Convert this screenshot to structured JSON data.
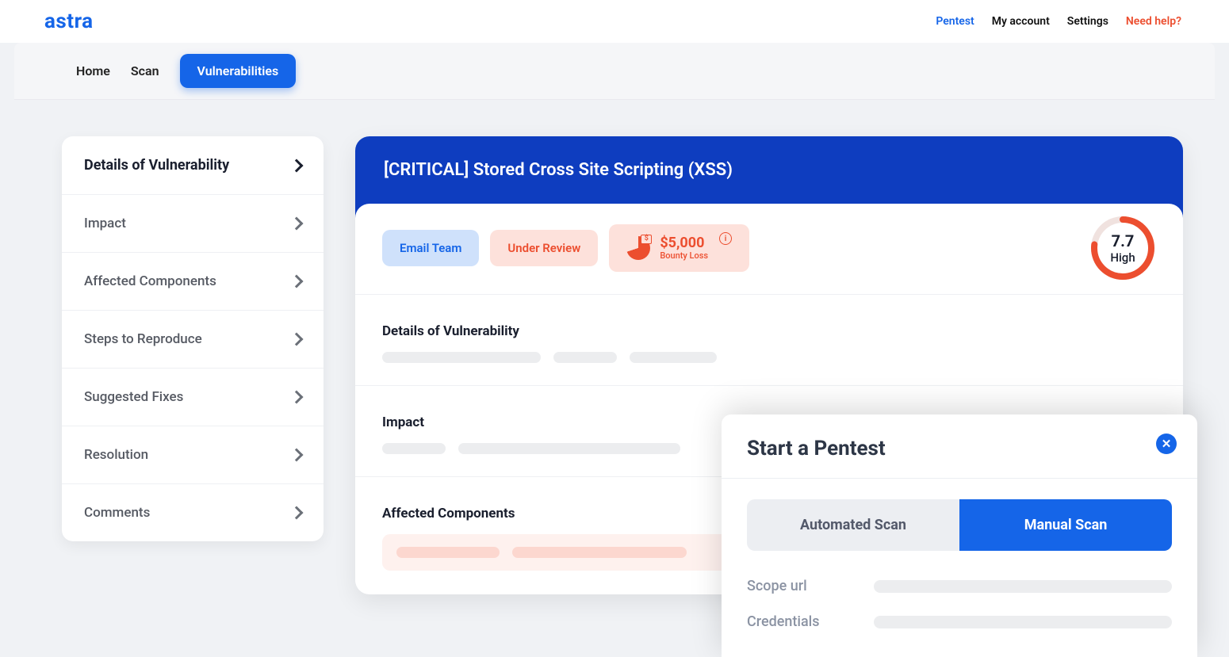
{
  "brand": "astra",
  "topnav": {
    "items": [
      {
        "label": "Pentest",
        "active": true
      },
      {
        "label": "My account",
        "active": false
      },
      {
        "label": "Settings",
        "active": false
      }
    ],
    "help": "Need help?"
  },
  "subnav": {
    "tabs": [
      {
        "label": "Home",
        "active": false
      },
      {
        "label": "Scan",
        "active": false
      },
      {
        "label": "Vulnerabilities",
        "active": true
      }
    ]
  },
  "sidebar": {
    "items": [
      {
        "label": "Details of Vulnerability",
        "active": true
      },
      {
        "label": "Impact",
        "active": false
      },
      {
        "label": "Affected Components",
        "active": false
      },
      {
        "label": "Steps to Reproduce",
        "active": false
      },
      {
        "label": "Suggested Fixes",
        "active": false
      },
      {
        "label": "Resolution",
        "active": false
      },
      {
        "label": "Comments",
        "active": false
      }
    ]
  },
  "vuln": {
    "title": "[CRITICAL] Stored Cross Site Scripting (XSS)",
    "email_btn": "Email Team",
    "status": "Under Review",
    "bounty_amount": "$5,000",
    "bounty_sub": "Bounty Loss",
    "score": "7.7",
    "severity": "High",
    "sections": {
      "details": "Details of Vulnerability",
      "impact": "Impact",
      "affected": "Affected Components"
    }
  },
  "modal": {
    "title": "Start a Pentest",
    "segments": [
      {
        "label": "Automated Scan",
        "active": false
      },
      {
        "label": "Manual Scan",
        "active": true
      }
    ],
    "fields": [
      {
        "label": "Scope url"
      },
      {
        "label": "Credentials"
      }
    ]
  }
}
